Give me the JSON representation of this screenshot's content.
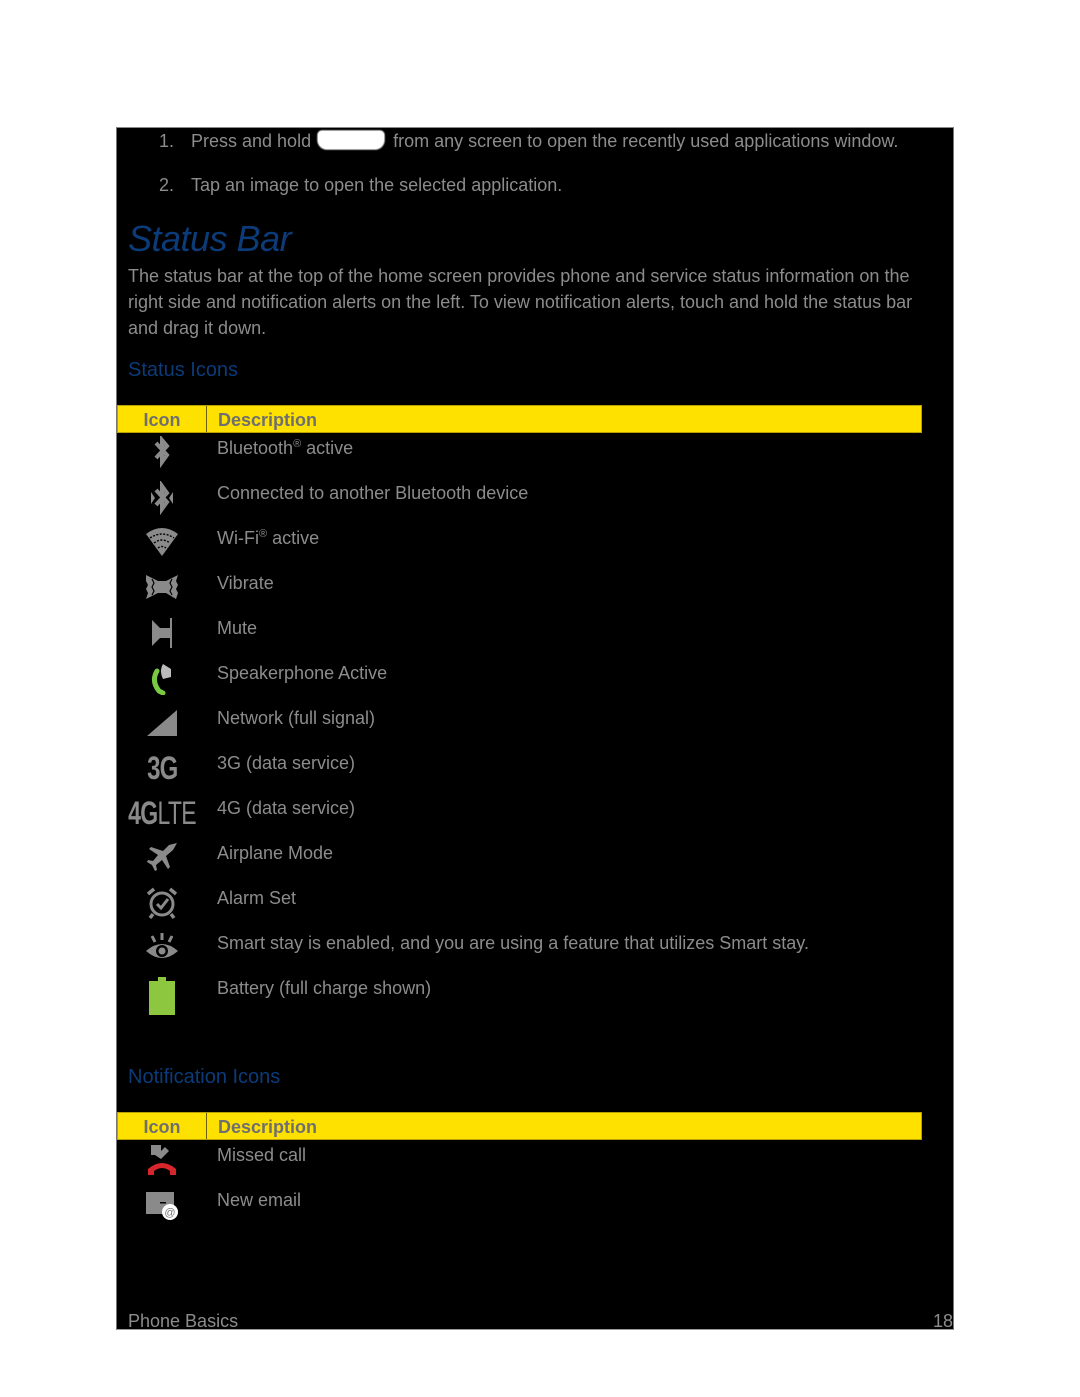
{
  "steps": [
    {
      "num": "1.",
      "before": "Press and hold",
      "after": "from any screen to open the recently used applications window.",
      "inline_icon": "home-key-icon"
    },
    {
      "num": "2.",
      "text": "Tap an image to open the selected application."
    }
  ],
  "section_title": "Status Bar",
  "intro": "The status bar at the top of the home screen provides phone and service status information on the right side and notification alerts on the left. To view notification alerts, touch and hold the status bar and drag it down.",
  "status_icons": {
    "heading": "Status Icons",
    "columns": [
      "Icon",
      "Description"
    ],
    "rows": [
      {
        "icon": "bluetooth-icon",
        "desc": "Bluetooth",
        "sup": "®",
        "desc_after": " active"
      },
      {
        "icon": "bluetooth-connected-icon",
        "desc": "Connected to another Bluetooth device"
      },
      {
        "icon": "wifi-icon",
        "desc": "Wi-Fi",
        "sup": "®",
        "desc_after": " active"
      },
      {
        "icon": "vibrate-icon",
        "desc": "Vibrate"
      },
      {
        "icon": "mute-icon",
        "desc": "Mute"
      },
      {
        "icon": "speakerphone-icon",
        "desc": "Speakerphone Active"
      },
      {
        "icon": "signal-icon",
        "desc": "Network (full signal)"
      },
      {
        "icon": "3g-icon",
        "desc": "3G (data service)",
        "icon_text": "3G"
      },
      {
        "icon": "4g-lte-icon",
        "desc": "4G (data service)",
        "icon_text_bold": "4G",
        "icon_text_light": "LTE"
      },
      {
        "icon": "airplane-icon",
        "desc": "Airplane Mode"
      },
      {
        "icon": "alarm-icon",
        "desc": "Alarm Set"
      },
      {
        "icon": "smart-stay-icon",
        "desc": "Smart stay is enabled, and you are using a feature that utilizes Smart stay."
      },
      {
        "icon": "battery-icon",
        "desc": "Battery (full charge shown)"
      }
    ]
  },
  "notification_icons": {
    "heading": "Notification Icons",
    "columns": [
      "Icon",
      "Description"
    ],
    "rows": [
      {
        "icon": "missed-call-icon",
        "desc": "Missed call"
      },
      {
        "icon": "new-email-icon",
        "desc": "New email"
      }
    ]
  },
  "footer": {
    "section": "Phone Basics",
    "page": "18"
  },
  "colors": {
    "header_yellow": "#ffe100",
    "heading_blue": "#0b3b78",
    "body_gray": "#8c8c8c",
    "battery_green": "#8dc63f",
    "call_green": "#7ac943",
    "missed_red": "#d7262b"
  }
}
